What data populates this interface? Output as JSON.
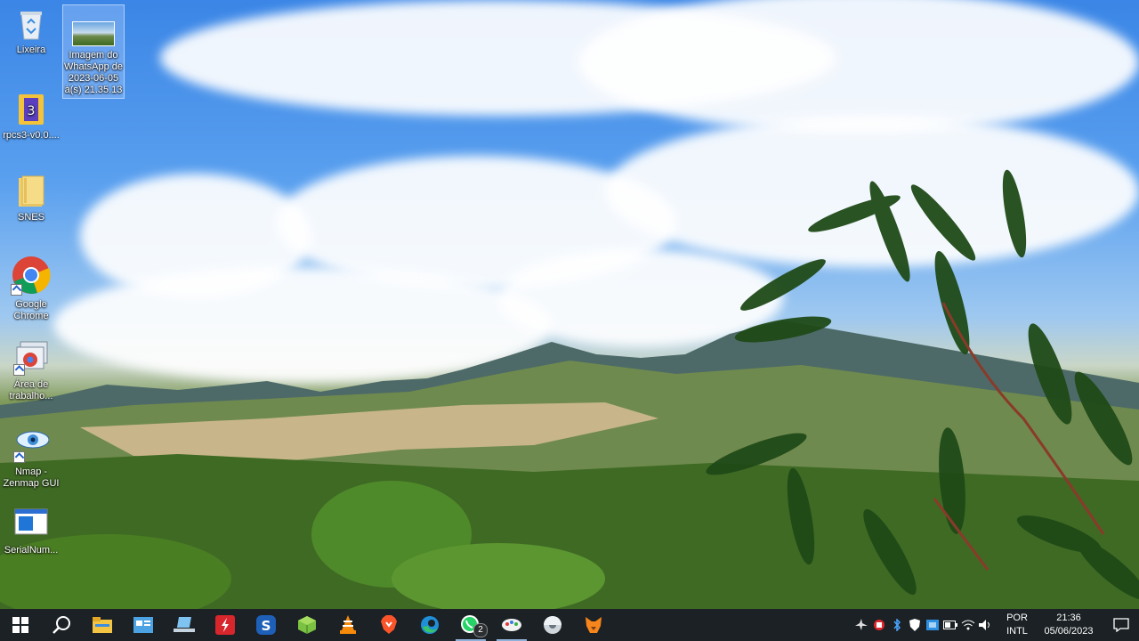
{
  "desktop_icons": [
    {
      "label": "Lixeira",
      "icon": "recycle-bin-icon"
    },
    {
      "label": "Imagem do WhatsApp de 2023-06-05 à(s) 21.35.13",
      "icon": "image-file-icon"
    },
    {
      "label": "rpcs3-v0.0....",
      "icon": "archive-icon"
    },
    {
      "label": "SNES",
      "icon": "folder-icon"
    },
    {
      "label": "Google Chrome",
      "icon": "chrome-icon"
    },
    {
      "label": "Área de trabalho...",
      "icon": "remote-desktop-icon"
    },
    {
      "label": "Nmap - Zenmap GUI",
      "icon": "nmap-eye-icon"
    },
    {
      "label": "SerialNum...",
      "icon": "app-window-icon"
    }
  ],
  "taskbar": {
    "apps": [
      "start",
      "search",
      "file-explorer",
      "control-panel",
      "laptop",
      "flash",
      "s-app",
      "cube-app",
      "vlc",
      "brave",
      "edge",
      "whatsapp",
      "paint-app",
      "disc-app",
      "metamask"
    ],
    "whatsapp_badge": "2"
  },
  "tray": {
    "language_top": "POR",
    "language_bottom": "INTL",
    "time": "21:36",
    "date": "05/06/2023"
  }
}
